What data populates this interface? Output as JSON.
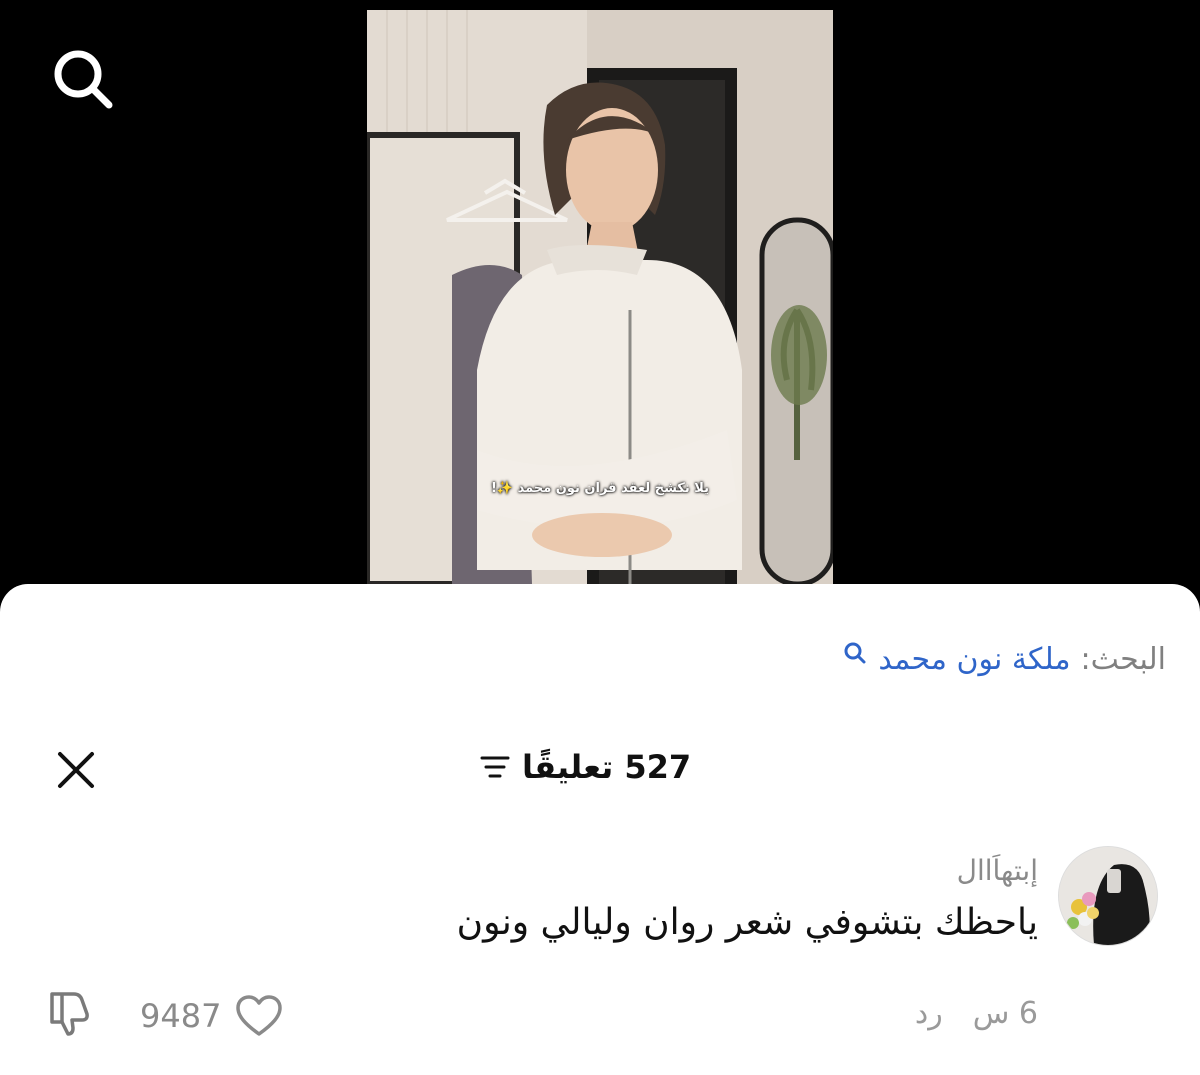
{
  "app": {
    "accent_color": "#2f65c9",
    "text_color": "#111111",
    "muted_color": "#8a8a8a"
  },
  "video": {
    "caption": "يلا نكشخ لعقد قران نون محمد ✨!"
  },
  "search_bar": {
    "label": "البحث:",
    "query": "ملكة نون محمد"
  },
  "comments_header": {
    "count_text": "527 تعليقًا"
  },
  "comments": [
    {
      "username": "إبتهاَاال",
      "text": "ياحظك بتشوفي شعر روان وليالي ونون",
      "time": "6 س",
      "reply_label": "رد",
      "likes": "9487"
    }
  ]
}
